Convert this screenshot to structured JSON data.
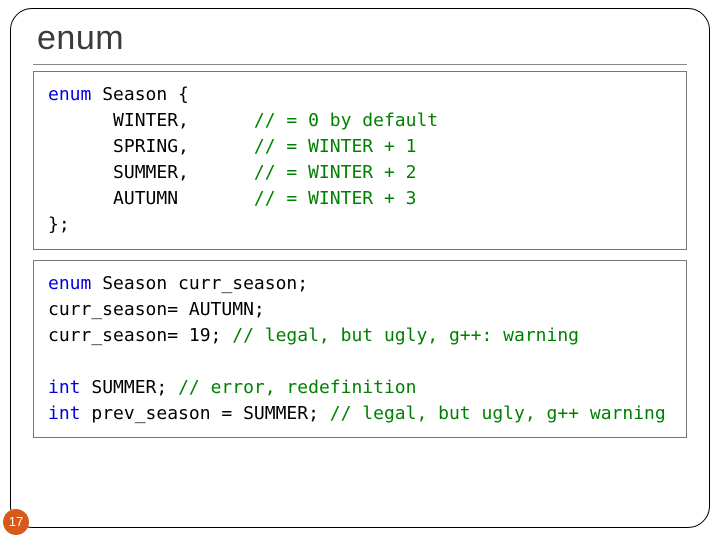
{
  "title": "enum",
  "slide_number": "17",
  "code1": {
    "l1a": "enum",
    "l1b": " Season {",
    "l2a": "      WINTER,      ",
    "l2b": "// = 0 by default",
    "l3a": "      SPRING,      ",
    "l3b": "// = WINTER + 1",
    "l4a": "      SUMMER,      ",
    "l4b": "// = WINTER + 2",
    "l5a": "      AUTUMN       ",
    "l5b": "// = WINTER + 3",
    "l6": "};"
  },
  "code2": {
    "l1a": "enum",
    "l1b": " Season curr_season;",
    "l2": "curr_season= AUTUMN;",
    "l3a": "curr_season= 19; ",
    "l3b": "// legal, but ugly, g++: warning",
    "blank": "",
    "l4a": "int",
    "l4b": " SUMMER; ",
    "l4c": "// error, redefinition",
    "l5a": "int",
    "l5b": " prev_season = SUMMER; ",
    "l5c": "// legal, but ugly, g++ warning"
  }
}
